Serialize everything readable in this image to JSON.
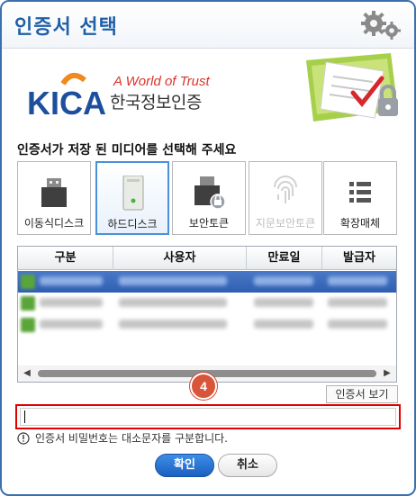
{
  "window": {
    "title": "인증서 선택"
  },
  "banner": {
    "logo_text": "KICA",
    "slogan": "A World of Trust",
    "org_name": "한국정보인증"
  },
  "instruction": "인증서가 저장 된 미디어를 선택해 주세요",
  "media": [
    {
      "label": "이동식디스크",
      "icon": "usb-drive-icon",
      "selected": false,
      "enabled": true
    },
    {
      "label": "하드디스크",
      "icon": "hard-disk-icon",
      "selected": true,
      "enabled": true
    },
    {
      "label": "보안토큰",
      "icon": "security-token-icon",
      "selected": false,
      "enabled": true
    },
    {
      "label": "지문보안토큰",
      "icon": "fingerprint-icon",
      "selected": false,
      "enabled": false
    },
    {
      "label": "확장매체",
      "icon": "list-icon",
      "selected": false,
      "enabled": true
    }
  ],
  "table": {
    "columns": [
      "구분",
      "사용자",
      "만료일",
      "발급자"
    ]
  },
  "step_badge": "4",
  "view_cert_label": "인증서 보기",
  "password": {
    "value": ""
  },
  "note": "인증서 비밀번호는 대소문자를 구분합니다.",
  "buttons": {
    "ok": "확인",
    "cancel": "취소"
  },
  "colors": {
    "accent": "#1f5fa8",
    "highlight_row": "#3a68ba",
    "alert_border": "#e00000",
    "badge": "#d8553a"
  }
}
